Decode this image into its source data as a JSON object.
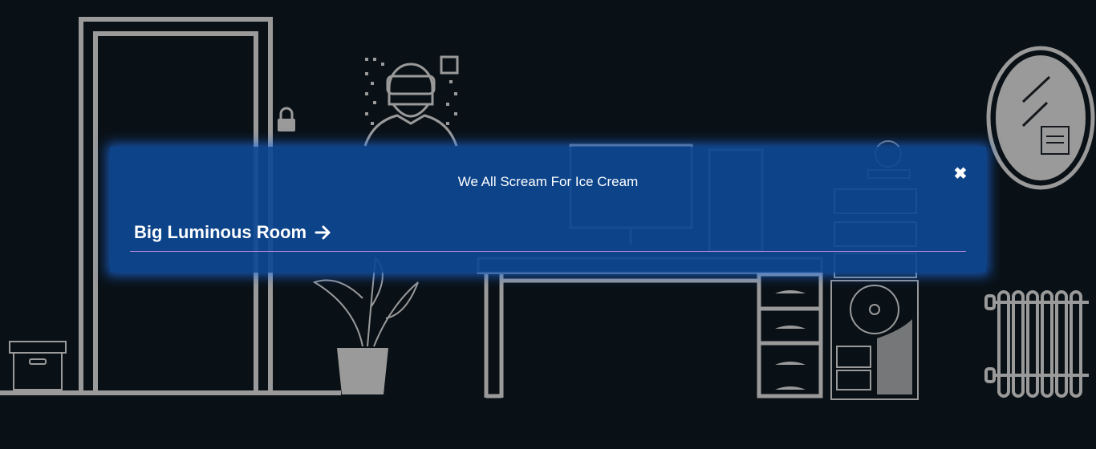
{
  "modal": {
    "title": "We All Scream For Ice Cream",
    "close_symbol": "✖",
    "room_link_label": "Big Luminous Room",
    "arrow_icon": "arrow-right-icon",
    "close_icon": "close-icon"
  },
  "colors": {
    "background": "#0a1116",
    "modal_background": "#0d4894",
    "glow": "#1e6ee6",
    "divider": "#c48bd8",
    "line_art": "#9a9a9a"
  }
}
